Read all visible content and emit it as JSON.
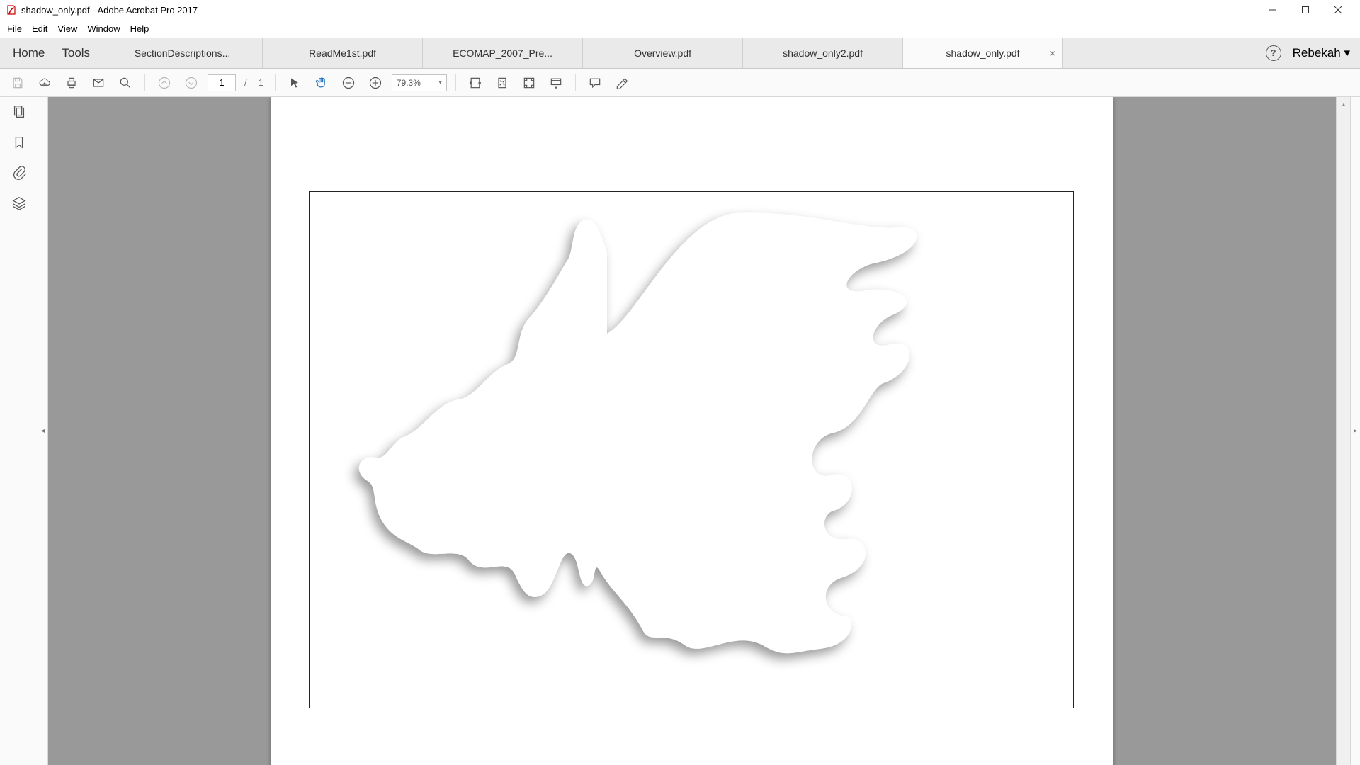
{
  "window": {
    "title": "shadow_only.pdf - Adobe Acrobat Pro 2017"
  },
  "menu": {
    "file": "File",
    "edit": "Edit",
    "view": "View",
    "window": "Window",
    "help": "Help"
  },
  "nav": {
    "home": "Home",
    "tools": "Tools"
  },
  "tabs": [
    {
      "label": "SectionDescriptions...",
      "active": false,
      "closable": false
    },
    {
      "label": "ReadMe1st.pdf",
      "active": false,
      "closable": false
    },
    {
      "label": "ECOMAP_2007_Pre...",
      "active": false,
      "closable": false
    },
    {
      "label": "Overview.pdf",
      "active": false,
      "closable": false
    },
    {
      "label": "shadow_only2.pdf",
      "active": false,
      "closable": false
    },
    {
      "label": "shadow_only.pdf",
      "active": true,
      "closable": true
    }
  ],
  "user": {
    "name": "Rebekah"
  },
  "toolbar": {
    "page_current": "1",
    "page_sep": "/",
    "page_total": "1",
    "zoom": "79.3%"
  },
  "close_glyph": "×",
  "caret_down": "▾",
  "caret_left": "◂",
  "caret_right": "▸",
  "caret_up_small": "▴",
  "help_glyph": "?"
}
